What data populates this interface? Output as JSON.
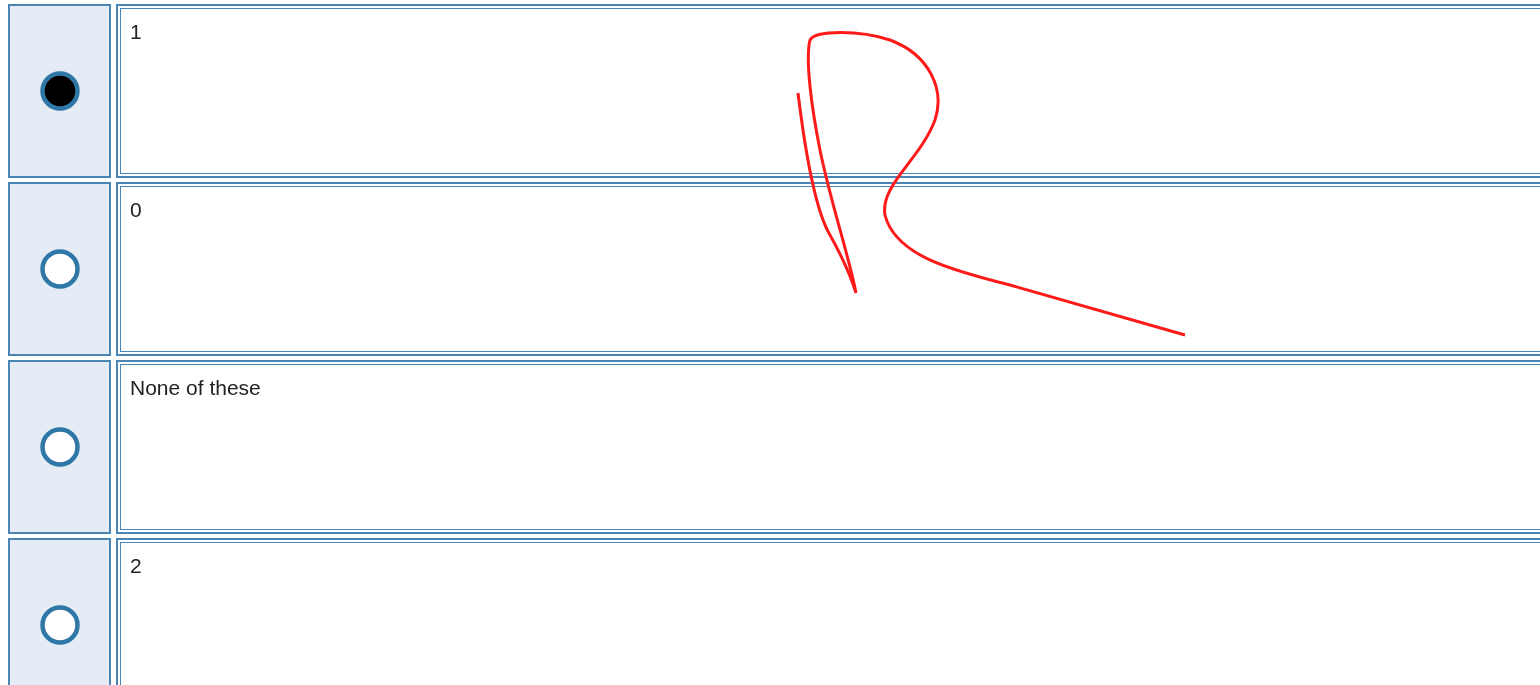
{
  "options": [
    {
      "label": "1",
      "selected": true
    },
    {
      "label": "0",
      "selected": false
    },
    {
      "label": "None of these",
      "selected": false
    },
    {
      "label": "2",
      "selected": false
    }
  ]
}
